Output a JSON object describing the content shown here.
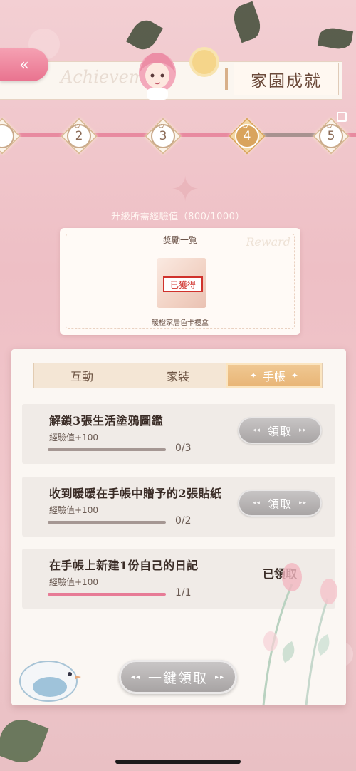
{
  "header": {
    "title": "家園成就",
    "script_text": "Achievement"
  },
  "levels": [
    {
      "tag": "LV",
      "number": "2",
      "state": "done"
    },
    {
      "tag": "LV",
      "number": "3",
      "state": "done"
    },
    {
      "tag": "LV",
      "number": "4",
      "state": "current"
    },
    {
      "tag": "LV",
      "number": "5",
      "state": "locked"
    }
  ],
  "exp": {
    "label": "升級所需經驗值（800/1000）",
    "current": 800,
    "required": 1000
  },
  "rewards": {
    "title": "獎勵一覧",
    "script_text": "Reward",
    "item_name": "暖橙家居色卡禮盒",
    "stamp": "已獲得"
  },
  "tabs": [
    {
      "label": "互動",
      "active": false
    },
    {
      "label": "家裝",
      "active": false
    },
    {
      "label": "手帳",
      "active": true
    }
  ],
  "tasks": [
    {
      "title": "解鎖3張生活塗鴉圖鑑",
      "exp": "經驗值+100",
      "progress_text": "0/3",
      "progress": 0,
      "action": "領取",
      "claimed": false
    },
    {
      "title": "收到暖暖在手帳中贈予的2張貼紙",
      "exp": "經驗值+100",
      "progress_text": "0/2",
      "progress": 0,
      "action": "領取",
      "claimed": false
    },
    {
      "title": "在手帳上新建1份自己的日記",
      "exp": "經驗值+100",
      "progress_text": "1/1",
      "progress": 1,
      "action": "已領取",
      "claimed": true
    }
  ],
  "claim_all": {
    "label": "一鍵領取"
  },
  "colors": {
    "accent_pink": "#e77b96",
    "gold": "#d9a45d",
    "button_gray": "#a7a3a3",
    "stamp_red": "#d0322c"
  }
}
